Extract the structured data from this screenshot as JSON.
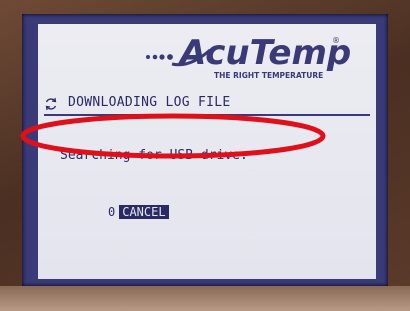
{
  "logo": {
    "brand": "AcuTemp",
    "registered_mark": "®",
    "tagline": "THE RIGHT TEMPERATURE"
  },
  "header": {
    "title": "DOWNLOADING LOG FILE",
    "icon": "refresh-icon"
  },
  "status": {
    "message": "Searching for USB drive."
  },
  "cancel": {
    "key": "0",
    "label": "CANCEL"
  },
  "colors": {
    "screen_frame": "#3a3a78",
    "display_bg": "#e4e4ee",
    "text": "#2a2a66",
    "annotation": "#e0101a"
  }
}
